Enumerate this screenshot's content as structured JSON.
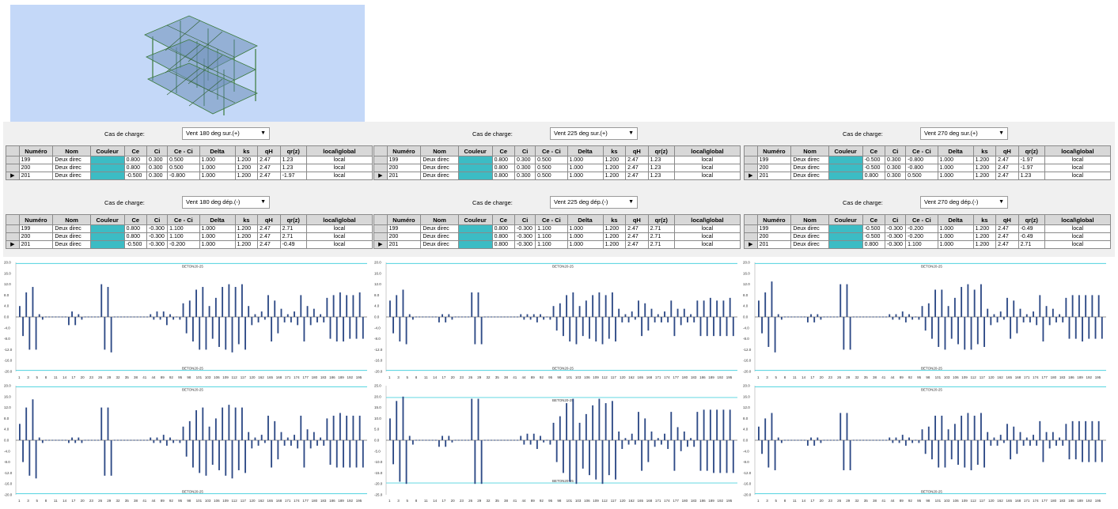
{
  "structure_view": {
    "icon": "building-frame-3d-icon"
  },
  "colors": {
    "color_cell": "#3cbcc4",
    "bar": "#2e4a86",
    "limit_line": "#4fd3df",
    "panel_bg": "#f0f0f0"
  },
  "columns": [
    "Numéro",
    "Nom",
    "Couleur",
    "Ce",
    "Ci",
    "Ce - Ci",
    "Delta",
    "ks",
    "qH",
    "qr(z)",
    "local\\global"
  ],
  "panels": [
    {
      "combo_label": "Cas de charge:",
      "combo_value": "Vent 180 deg sur.(+)",
      "rows": [
        {
          "num": "199",
          "nom": "Deux direc",
          "ce": "0.800",
          "ci": "0.300",
          "ceci": "0.500",
          "delta": "1.000",
          "ks": "1.200",
          "qh": "2.47",
          "qr": "1.23",
          "lg": "local"
        },
        {
          "num": "200",
          "nom": "Deux direc",
          "ce": "0.800",
          "ci": "0.300",
          "ceci": "0.500",
          "delta": "1.000",
          "ks": "1.200",
          "qh": "2.47",
          "qr": "1.23",
          "lg": "local"
        },
        {
          "num": "201",
          "nom": "Deux direc",
          "ce": "-0.500",
          "ci": "0.300",
          "ceci": "-0.800",
          "delta": "1.000",
          "ks": "1.200",
          "qh": "2.47",
          "qr": "-1.97",
          "lg": "local"
        }
      ]
    },
    {
      "combo_label": "Cas de charge:",
      "combo_value": "Vent 225 deg sur.(+)",
      "rows": [
        {
          "num": "199",
          "nom": "Deux direc",
          "ce": "0.800",
          "ci": "0.300",
          "ceci": "0.500",
          "delta": "1.000",
          "ks": "1.200",
          "qh": "2.47",
          "qr": "1.23",
          "lg": "local"
        },
        {
          "num": "200",
          "nom": "Deux direc",
          "ce": "0.800",
          "ci": "0.300",
          "ceci": "0.500",
          "delta": "1.000",
          "ks": "1.200",
          "qh": "2.47",
          "qr": "1.23",
          "lg": "local"
        },
        {
          "num": "201",
          "nom": "Deux direc",
          "ce": "0.800",
          "ci": "0.300",
          "ceci": "0.500",
          "delta": "1.000",
          "ks": "1.200",
          "qh": "2.47",
          "qr": "1.23",
          "lg": "local"
        }
      ]
    },
    {
      "combo_label": "Cas de charge:",
      "combo_value": "Vent 270 deg sur.(+)",
      "rows": [
        {
          "num": "199",
          "nom": "Deux direc",
          "ce": "-0.500",
          "ci": "0.300",
          "ceci": "-0.800",
          "delta": "1.000",
          "ks": "1.200",
          "qh": "2.47",
          "qr": "-1.97",
          "lg": "local"
        },
        {
          "num": "200",
          "nom": "Deux direc",
          "ce": "-0.500",
          "ci": "0.300",
          "ceci": "-0.800",
          "delta": "1.000",
          "ks": "1.200",
          "qh": "2.47",
          "qr": "-1.97",
          "lg": "local"
        },
        {
          "num": "201",
          "nom": "Deux direc",
          "ce": "0.800",
          "ci": "0.300",
          "ceci": "0.500",
          "delta": "1.000",
          "ks": "1.200",
          "qh": "2.47",
          "qr": "1.23",
          "lg": "local"
        }
      ]
    },
    {
      "combo_label": "Cas de charge:",
      "combo_value": "Vent 180 deg dép.(-)",
      "rows": [
        {
          "num": "199",
          "nom": "Deux direc",
          "ce": "0.800",
          "ci": "-0.300",
          "ceci": "1.100",
          "delta": "1.000",
          "ks": "1.200",
          "qh": "2.47",
          "qr": "2.71",
          "lg": "local"
        },
        {
          "num": "200",
          "nom": "Deux direc",
          "ce": "0.800",
          "ci": "-0.300",
          "ceci": "1.100",
          "delta": "1.000",
          "ks": "1.200",
          "qh": "2.47",
          "qr": "2.71",
          "lg": "local"
        },
        {
          "num": "201",
          "nom": "Deux direc",
          "ce": "-0.500",
          "ci": "-0.300",
          "ceci": "-0.200",
          "delta": "1.000",
          "ks": "1.200",
          "qh": "2.47",
          "qr": "-0.49",
          "lg": "local"
        }
      ]
    },
    {
      "combo_label": "Cas de charge:",
      "combo_value": "Vent 225 deg dép.(-)",
      "rows": [
        {
          "num": "199",
          "nom": "Deux direc",
          "ce": "0.800",
          "ci": "-0.300",
          "ceci": "1.100",
          "delta": "1.000",
          "ks": "1.200",
          "qh": "2.47",
          "qr": "2.71",
          "lg": "local"
        },
        {
          "num": "200",
          "nom": "Deux direc",
          "ce": "0.800",
          "ci": "-0.300",
          "ceci": "1.100",
          "delta": "1.000",
          "ks": "1.200",
          "qh": "2.47",
          "qr": "2.71",
          "lg": "local"
        },
        {
          "num": "201",
          "nom": "Deux direc",
          "ce": "0.800",
          "ci": "-0.300",
          "ceci": "1.100",
          "delta": "1.000",
          "ks": "1.200",
          "qh": "2.47",
          "qr": "2.71",
          "lg": "local"
        }
      ]
    },
    {
      "combo_label": "Cas de charge:",
      "combo_value": "Vent 270 deg dép.(-)",
      "rows": [
        {
          "num": "199",
          "nom": "Deux direc",
          "ce": "-0.500",
          "ci": "-0.300",
          "ceci": "-0.200",
          "delta": "1.000",
          "ks": "1.200",
          "qh": "2.47",
          "qr": "-0.49",
          "lg": "local"
        },
        {
          "num": "200",
          "nom": "Deux direc",
          "ce": "-0.500",
          "ci": "-0.300",
          "ceci": "-0.200",
          "delta": "1.000",
          "ks": "1.200",
          "qh": "2.47",
          "qr": "-0.49",
          "lg": "local"
        },
        {
          "num": "201",
          "nom": "Deux direc",
          "ce": "0.800",
          "ci": "-0.300",
          "ceci": "1.100",
          "delta": "1.000",
          "ks": "1.200",
          "qh": "2.47",
          "qr": "2.71",
          "lg": "local"
        }
      ]
    }
  ],
  "chart_data": [
    {
      "type": "bar",
      "limit_label": "BETON20-25",
      "yticks": [
        "20.0",
        "16.0",
        "12.0",
        "8.0",
        "4.0",
        "0.0",
        "-4.0",
        "-8.0",
        "-12.0",
        "-16.0",
        "-20.0"
      ],
      "ylim": [
        -20,
        20
      ],
      "limit_upper": 19.6,
      "limit_lower": -19.6,
      "xticks": [
        "1",
        "3",
        "5",
        "8",
        "11",
        "14",
        "17",
        "20",
        "23",
        "26",
        "29",
        "32",
        "35",
        "38",
        "41",
        "44",
        "89",
        "92",
        "95",
        "98",
        "101",
        "103",
        "106",
        "109",
        "112",
        "117",
        "120",
        "162",
        "165",
        "168",
        "171",
        "174",
        "177",
        "180",
        "183",
        "186",
        "189",
        "192",
        "195"
      ],
      "values": [
        4,
        -7,
        9,
        -12,
        11,
        -12,
        1,
        -1,
        0,
        0,
        0,
        0,
        0,
        0,
        0,
        -3,
        2,
        -3,
        1,
        -1,
        0,
        0,
        0,
        0,
        0,
        12,
        -12,
        11,
        -13,
        0,
        0,
        0,
        0,
        0,
        0,
        0,
        0,
        0,
        0,
        0,
        1,
        -1,
        2,
        -1,
        2,
        -3,
        1,
        -1,
        0,
        -1,
        5,
        -6,
        6,
        -9,
        10,
        -12,
        11,
        -12,
        4,
        -8,
        7,
        -11,
        11,
        -12,
        12,
        -13,
        11,
        -10,
        12,
        -12,
        4,
        -3,
        1,
        -2,
        2,
        -1,
        8,
        -9,
        6,
        -6,
        3,
        -2,
        1,
        -2,
        2,
        -3,
        8,
        -9,
        4,
        -3,
        3,
        -2,
        1,
        -2,
        7,
        -8,
        8,
        -9,
        9,
        -9,
        8,
        -8,
        8,
        -8,
        9,
        -8
      ]
    },
    {
      "type": "bar",
      "limit_label": "BETON20-25",
      "yticks": [
        "20.0",
        "16.0",
        "12.0",
        "8.0",
        "4.0",
        "0.0",
        "-4.0",
        "-8.0",
        "-12.0",
        "-16.0",
        "-20.0"
      ],
      "ylim": [
        -20,
        20
      ],
      "limit_upper": 19.6,
      "limit_lower": -19.6,
      "xticks": [
        "1",
        "3",
        "5",
        "8",
        "11",
        "14",
        "17",
        "20",
        "23",
        "26",
        "29",
        "32",
        "35",
        "38",
        "41",
        "44",
        "89",
        "92",
        "95",
        "98",
        "101",
        "103",
        "106",
        "109",
        "112",
        "117",
        "120",
        "162",
        "165",
        "168",
        "171",
        "174",
        "177",
        "180",
        "183",
        "186",
        "189",
        "192",
        "195"
      ],
      "values": [
        6,
        -6,
        8,
        -9,
        10,
        -10,
        1,
        -1,
        0,
        0,
        0,
        0,
        0,
        0,
        0,
        -2,
        1,
        -2,
        1,
        -1,
        0,
        0,
        0,
        0,
        0,
        9,
        -10,
        9,
        -10,
        0,
        0,
        0,
        0,
        0,
        0,
        0,
        0,
        0,
        0,
        0,
        1,
        -1,
        1,
        -1,
        1,
        -2,
        1,
        -1,
        0,
        -1,
        4,
        -5,
        5,
        -7,
        8,
        -9,
        9,
        -10,
        4,
        -7,
        6,
        -8,
        8,
        -9,
        9,
        -10,
        8,
        -8,
        9,
        -9,
        3,
        -2,
        1,
        -2,
        2,
        -1,
        6,
        -7,
        5,
        -5,
        3,
        -2,
        1,
        -2,
        2,
        -2,
        6,
        -7,
        3,
        -3,
        3,
        -2,
        1,
        -2,
        6,
        -7,
        6,
        -7,
        7,
        -7,
        6,
        -7,
        6,
        -7,
        7,
        -7
      ]
    },
    {
      "type": "bar",
      "limit_label": "BETON20-25",
      "yticks": [
        "20.0",
        "16.0",
        "12.0",
        "8.0",
        "4.0",
        "0.0",
        "-4.0",
        "-8.0",
        "-12.0",
        "-16.0",
        "-20.0"
      ],
      "ylim": [
        -20,
        20
      ],
      "limit_upper": 19.6,
      "limit_lower": -19.6,
      "xticks": [
        "1",
        "3",
        "5",
        "8",
        "11",
        "14",
        "17",
        "20",
        "23",
        "26",
        "29",
        "32",
        "35",
        "38",
        "41",
        "44",
        "89",
        "92",
        "95",
        "98",
        "101",
        "103",
        "106",
        "109",
        "112",
        "117",
        "120",
        "162",
        "165",
        "168",
        "171",
        "174",
        "177",
        "180",
        "183",
        "186",
        "189",
        "192",
        "195"
      ],
      "values": [
        6,
        -6,
        9,
        -11,
        13,
        -13,
        1,
        -1,
        0,
        0,
        0,
        0,
        0,
        0,
        0,
        -2,
        1,
        -2,
        1,
        -1,
        0,
        0,
        0,
        0,
        0,
        12,
        -12,
        12,
        -12,
        0,
        0,
        0,
        0,
        0,
        0,
        0,
        0,
        0,
        0,
        0,
        1,
        -1,
        1,
        -1,
        2,
        -2,
        1,
        -1,
        0,
        -1,
        4,
        -5,
        5,
        -8,
        10,
        -11,
        10,
        -12,
        4,
        -8,
        7,
        -10,
        11,
        -12,
        12,
        -12,
        10,
        -10,
        12,
        -11,
        3,
        -3,
        1,
        -2,
        2,
        -1,
        7,
        -8,
        6,
        -6,
        3,
        -2,
        1,
        -2,
        2,
        -3,
        8,
        -9,
        4,
        -3,
        3,
        -2,
        1,
        -2,
        7,
        -8,
        8,
        -8,
        8,
        -9,
        8,
        -8,
        8,
        -8,
        8,
        -8
      ]
    },
    {
      "type": "bar",
      "limit_label": "BETON20-25",
      "yticks": [
        "20.0",
        "16.0",
        "12.0",
        "8.0",
        "4.0",
        "0.0",
        "-4.0",
        "-8.0",
        "-12.0",
        "-16.0",
        "-20.0"
      ],
      "ylim": [
        -20,
        20
      ],
      "limit_upper": 19.6,
      "limit_lower": -19.6,
      "xticks": [
        "1",
        "3",
        "5",
        "8",
        "11",
        "14",
        "17",
        "20",
        "23",
        "26",
        "29",
        "32",
        "35",
        "38",
        "41",
        "44",
        "89",
        "92",
        "95",
        "98",
        "101",
        "103",
        "106",
        "109",
        "112",
        "117",
        "120",
        "162",
        "165",
        "168",
        "171",
        "174",
        "177",
        "180",
        "183",
        "186",
        "189",
        "192",
        "195"
      ],
      "values": [
        6,
        -8,
        12,
        -13,
        15,
        -14,
        1,
        -1,
        0,
        0,
        0,
        0,
        0,
        0,
        0,
        -1,
        1,
        -1,
        1,
        -1,
        0,
        0,
        0,
        0,
        0,
        12,
        -13,
        12,
        -13,
        0,
        0,
        0,
        0,
        0,
        0,
        0,
        0,
        0,
        0,
        0,
        1,
        -1,
        1,
        -1,
        2,
        -2,
        1,
        -1,
        0,
        -1,
        5,
        -6,
        7,
        -10,
        11,
        -12,
        12,
        -13,
        5,
        -9,
        8,
        -11,
        12,
        -13,
        13,
        -14,
        12,
        -11,
        12,
        -12,
        3,
        -3,
        1,
        -2,
        2,
        -1,
        9,
        -10,
        7,
        -7,
        3,
        -2,
        1,
        -2,
        2,
        -3,
        9,
        -10,
        4,
        -3,
        3,
        -2,
        1,
        -2,
        8,
        -9,
        9,
        -10,
        10,
        -10,
        9,
        -10,
        9,
        -10,
        9,
        -10
      ]
    },
    {
      "type": "bar",
      "limit_label": "BETON20-25",
      "yticks": [
        "25.0",
        "20.0",
        "15.0",
        "10.0",
        "5.0",
        "0.0",
        "-5.0",
        "-10.0",
        "-15.0",
        "-20.0",
        "-25.0"
      ],
      "ylim": [
        -25,
        25
      ],
      "limit_upper": 19.6,
      "limit_lower": -19.6,
      "xticks": [
        "1",
        "3",
        "5",
        "8",
        "11",
        "14",
        "17",
        "20",
        "23",
        "26",
        "29",
        "32",
        "35",
        "38",
        "41",
        "44",
        "89",
        "92",
        "95",
        "98",
        "101",
        "103",
        "106",
        "109",
        "112",
        "117",
        "120",
        "162",
        "165",
        "168",
        "171",
        "174",
        "177",
        "180",
        "183",
        "186",
        "189",
        "192",
        "195"
      ],
      "values": [
        10,
        -11,
        18,
        -19,
        20,
        -20,
        2,
        -2,
        0,
        0,
        0,
        0,
        0,
        0,
        0,
        -3,
        2,
        -3,
        2,
        -1,
        0,
        0,
        0,
        0,
        0,
        19,
        -20,
        19,
        -20,
        0,
        0,
        0,
        0,
        0,
        0,
        0,
        0,
        0,
        0,
        0,
        2,
        -2,
        3,
        -2,
        3,
        -4,
        2,
        -1,
        0,
        -2,
        8,
        -10,
        11,
        -15,
        17,
        -19,
        19,
        -20,
        8,
        -13,
        12,
        -16,
        16,
        -18,
        19,
        -20,
        17,
        -16,
        18,
        -18,
        4,
        -4,
        1,
        -2,
        3,
        -2,
        13,
        -14,
        10,
        -10,
        4,
        -3,
        1,
        -2,
        3,
        -4,
        13,
        -14,
        6,
        -5,
        4,
        -3,
        1,
        -3,
        13,
        -14,
        14,
        -14,
        14,
        -15,
        14,
        -15,
        14,
        -15,
        14,
        -15
      ]
    },
    {
      "type": "bar",
      "limit_label": "BETON20-25",
      "yticks": [
        "20.0",
        "16.0",
        "12.0",
        "8.0",
        "4.0",
        "0.0",
        "-4.0",
        "-8.0",
        "-12.0",
        "-16.0",
        "-20.0"
      ],
      "ylim": [
        -20,
        20
      ],
      "limit_upper": 19.6,
      "limit_lower": -19.6,
      "xticks": [
        "1",
        "3",
        "5",
        "8",
        "11",
        "14",
        "17",
        "20",
        "23",
        "26",
        "29",
        "32",
        "35",
        "38",
        "41",
        "44",
        "89",
        "92",
        "95",
        "98",
        "101",
        "103",
        "106",
        "109",
        "112",
        "117",
        "120",
        "162",
        "165",
        "168",
        "171",
        "174",
        "177",
        "180",
        "183",
        "186",
        "189",
        "192",
        "195"
      ],
      "values": [
        5,
        -5,
        8,
        -10,
        10,
        -11,
        1,
        -1,
        0,
        0,
        0,
        0,
        0,
        0,
        0,
        -2,
        1,
        -2,
        1,
        -1,
        0,
        0,
        0,
        0,
        0,
        10,
        -11,
        10,
        -11,
        0,
        0,
        0,
        0,
        0,
        0,
        0,
        0,
        0,
        0,
        0,
        1,
        -1,
        1,
        -1,
        2,
        -2,
        1,
        -1,
        0,
        -1,
        4,
        -5,
        5,
        -7,
        9,
        -10,
        9,
        -10,
        4,
        -7,
        6,
        -9,
        9,
        -10,
        10,
        -11,
        9,
        -9,
        10,
        -10,
        3,
        -2,
        1,
        -2,
        2,
        -1,
        6,
        -7,
        5,
        -5,
        3,
        -2,
        1,
        -2,
        2,
        -2,
        7,
        -8,
        3,
        -3,
        3,
        -2,
        1,
        -2,
        6,
        -7,
        7,
        -7,
        7,
        -8,
        7,
        -8,
        7,
        -8,
        7,
        -8
      ]
    }
  ]
}
